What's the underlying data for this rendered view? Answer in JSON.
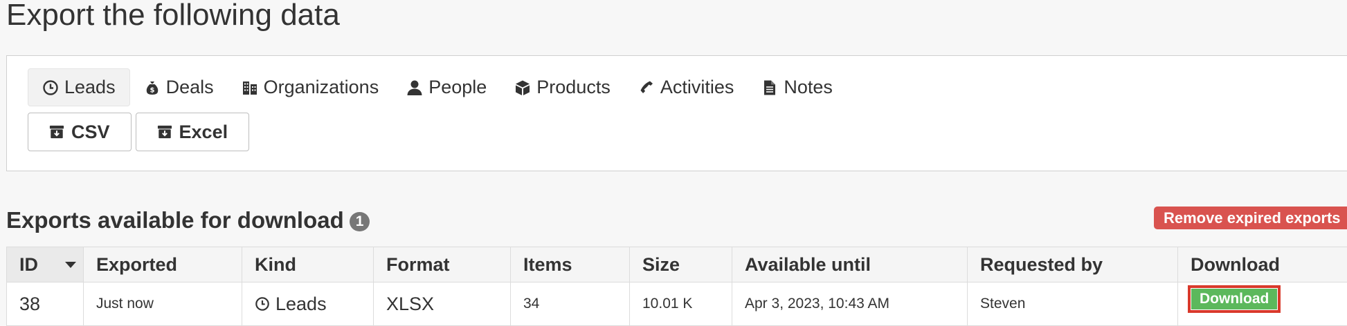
{
  "page": {
    "title": "Export the following data"
  },
  "tabs": [
    {
      "label": "Leads",
      "icon": "clock-icon",
      "active": true
    },
    {
      "label": "Deals",
      "icon": "money-bag-icon"
    },
    {
      "label": "Organizations",
      "icon": "building-icon"
    },
    {
      "label": "People",
      "icon": "person-icon"
    },
    {
      "label": "Products",
      "icon": "box-icon"
    },
    {
      "label": "Activities",
      "icon": "phone-icon"
    },
    {
      "label": "Notes",
      "icon": "file-icon"
    }
  ],
  "formats": [
    {
      "label": "CSV",
      "icon": "download-archive-icon"
    },
    {
      "label": "Excel",
      "icon": "download-archive-icon"
    }
  ],
  "exports_section": {
    "title": "Exports available for download",
    "count": "1",
    "remove_label": "Remove expired exports",
    "remove_color": "#d9534f"
  },
  "table": {
    "columns": [
      "ID",
      "Exported",
      "Kind",
      "Format",
      "Items",
      "Size",
      "Available until",
      "Requested by",
      "Download"
    ],
    "rows": [
      {
        "id": "38",
        "exported": "Just now",
        "kind": "Leads",
        "format": "XLSX",
        "items": "34",
        "size": "10.01 K",
        "available_until": "Apr 3, 2023, 10:43 AM",
        "requested_by": "Steven",
        "download_label": "Download"
      }
    ]
  }
}
